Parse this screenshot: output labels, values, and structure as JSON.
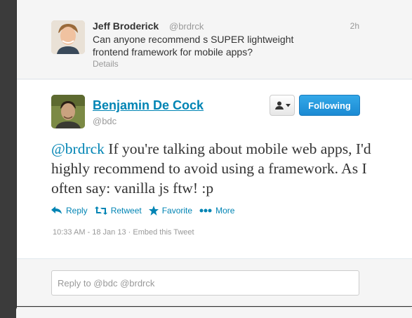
{
  "parent_tweet": {
    "fullname": "Jeff Broderick",
    "screenname": "@brdrck",
    "time": "2h",
    "text": "Can anyone recommend s SUPER lightweight frontend framework for mobile apps?",
    "details_label": "Details"
  },
  "main_tweet": {
    "fullname": "Benjamin De Cock",
    "screenname": "@bdc",
    "follow_label": "Following",
    "mention": "@brdrck",
    "text": " If you're talking about mobile web apps, I'd highly recommend to avoid using a framework. As I often say: vanilla js ftw! :p",
    "actions": {
      "reply": "Reply",
      "retweet": "Retweet",
      "favorite": "Favorite",
      "more": "More"
    },
    "timestamp": "10:33 AM - 18 Jan 13",
    "separator": " · ",
    "embed_label": "Embed this Tweet"
  },
  "reply_box": {
    "placeholder": "Reply to @bdc @brdrck"
  },
  "colors": {
    "link": "#0084b4",
    "follow_button": "#2aa1e0",
    "background": "#3b3b3b"
  }
}
